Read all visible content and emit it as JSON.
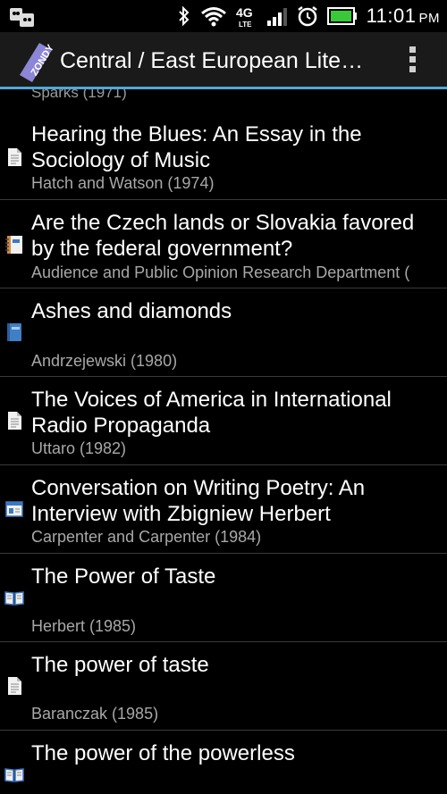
{
  "statusbar": {
    "time": "11:01",
    "ampm": "PM"
  },
  "app": {
    "logo_text": "ZONDY",
    "title": "Central / East European Lite…"
  },
  "list": {
    "partial_top": "Sparks (1971)",
    "items": [
      {
        "title": "Hearing the Blues: An Essay in the Sociology of Music",
        "subtitle": "Hatch and Watson (1974)",
        "icon": "document-icon"
      },
      {
        "title": "Are the Czech lands or Slovakia favored by the federal government?",
        "subtitle": "Audience and Public Opinion Research Department (",
        "icon": "notebook-icon"
      },
      {
        "title": "Ashes and diamonds",
        "subtitle": "Andrzejewski (1980)",
        "icon": "book-icon"
      },
      {
        "title": "The Voices of America in International Radio Propaganda",
        "subtitle": "Uttaro (1982)",
        "icon": "document-icon"
      },
      {
        "title": "Conversation on Writing Poetry: An Interview with Zbigniew Herbert",
        "subtitle": "Carpenter and Carpenter (1984)",
        "icon": "webpage-icon"
      },
      {
        "title": "The Power of Taste",
        "subtitle": "Herbert (1985)",
        "icon": "open-book-icon"
      },
      {
        "title": "The power of taste",
        "subtitle": "Baranczak (1985)",
        "icon": "document-icon"
      },
      {
        "title": "The power of the powerless",
        "subtitle": "",
        "icon": "open-book-icon"
      }
    ]
  }
}
